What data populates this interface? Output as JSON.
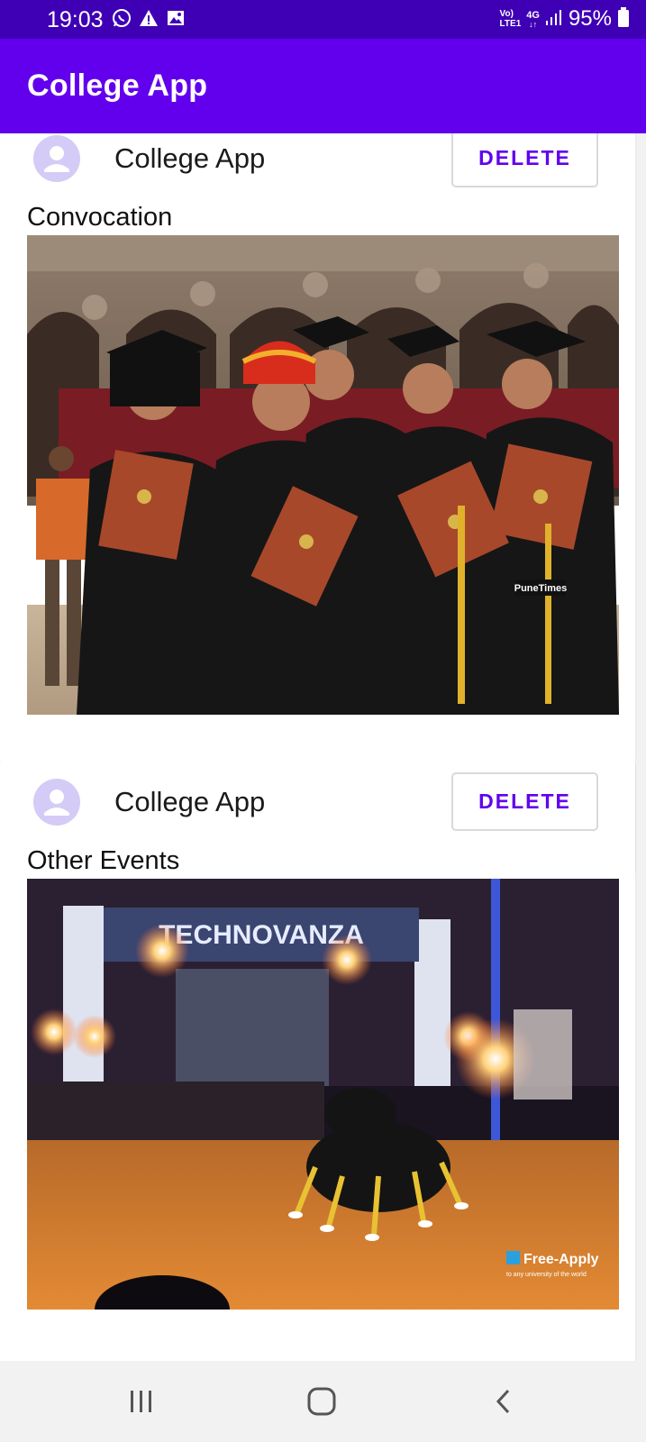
{
  "status_bar": {
    "time": "19:03",
    "network_top": "Vo)",
    "network_bottom": "LTE1",
    "network_type": "4G",
    "network_arrows": "↓↑",
    "battery": "95%"
  },
  "app_bar": {
    "title": "College App"
  },
  "posts": [
    {
      "author": "College App",
      "delete_label": "DELETE",
      "caption": "Convocation",
      "image_icon": "graduation-photo"
    },
    {
      "author": "College App",
      "delete_label": "DELETE",
      "caption": "Other Events",
      "image_icon": "event-photo"
    }
  ],
  "photo_text": {
    "watermark1": "PuneTimes",
    "banner": "TECHNOVANZA",
    "watermark2": "Free-Apply",
    "watermark2_sub": "to any university of the world"
  },
  "nav_bar": {
    "recents_icon": "recents-icon",
    "home_icon": "home-icon",
    "back_icon": "back-icon"
  },
  "colors": {
    "status_bar": "#3f00b5",
    "primary": "#6200ee",
    "avatar_bg": "#d4cbf6"
  }
}
